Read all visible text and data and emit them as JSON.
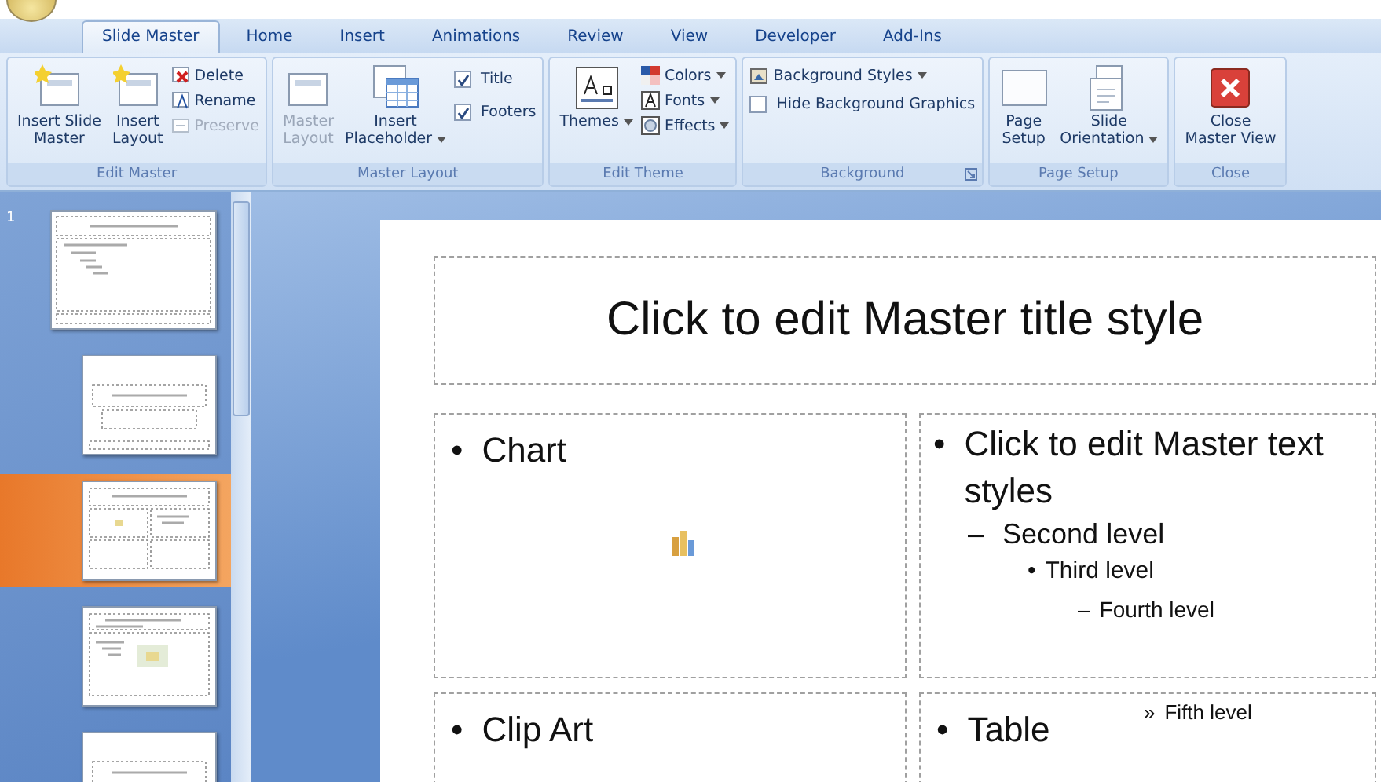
{
  "tabs": [
    {
      "label": "Slide Master",
      "selected": true
    },
    {
      "label": "Home",
      "selected": false
    },
    {
      "label": "Insert",
      "selected": false
    },
    {
      "label": "Animations",
      "selected": false
    },
    {
      "label": "Review",
      "selected": false
    },
    {
      "label": "View",
      "selected": false
    },
    {
      "label": "Developer",
      "selected": false
    },
    {
      "label": "Add-Ins",
      "selected": false
    }
  ],
  "ribbon_groups": [
    {
      "label": "Edit Master",
      "controls": [
        {
          "kind": "large",
          "lines": [
            "Insert Slide",
            "Master"
          ],
          "disabled": false,
          "dropdown": false
        },
        {
          "kind": "large",
          "lines": [
            "Insert",
            "Layout"
          ],
          "disabled": false,
          "dropdown": false
        },
        {
          "kind": "stack",
          "items": [
            {
              "kind": "small",
              "label": "Delete",
              "disabled": false,
              "dropdown": false
            },
            {
              "kind": "small",
              "label": "Rename",
              "disabled": false,
              "dropdown": false
            },
            {
              "kind": "small",
              "label": "Preserve",
              "disabled": true,
              "dropdown": false
            }
          ]
        }
      ]
    },
    {
      "label": "Master Layout",
      "controls": [
        {
          "kind": "large",
          "lines": [
            "Master",
            "Layout"
          ],
          "disabled": true,
          "dropdown": false
        },
        {
          "kind": "large",
          "lines": [
            "Insert",
            "Placeholder"
          ],
          "disabled": false,
          "dropdown": true
        },
        {
          "kind": "stack",
          "items": [
            {
              "kind": "checkbox",
              "label": "Title",
              "checked": true
            },
            {
              "kind": "checkbox",
              "label": "Footers",
              "checked": true
            }
          ]
        }
      ]
    },
    {
      "label": "Edit Theme",
      "controls": [
        {
          "kind": "large",
          "lines": [
            "Themes"
          ],
          "disabled": false,
          "dropdown": true
        },
        {
          "kind": "stack",
          "items": [
            {
              "kind": "small",
              "label": "Colors",
              "disabled": false,
              "dropdown": true
            },
            {
              "kind": "small",
              "label": "Fonts",
              "disabled": false,
              "dropdown": true
            },
            {
              "kind": "small",
              "label": "Effects",
              "disabled": false,
              "dropdown": true
            }
          ]
        }
      ]
    },
    {
      "label": "Background",
      "launcher": true,
      "controls": [
        {
          "kind": "stack",
          "items": [
            {
              "kind": "small",
              "label": "Background Styles",
              "disabled": false,
              "dropdown": true
            },
            {
              "kind": "checkbox",
              "label": "Hide Background Graphics",
              "checked": false
            }
          ]
        }
      ]
    },
    {
      "label": "Page Setup",
      "controls": [
        {
          "kind": "large",
          "lines": [
            "Page",
            "Setup"
          ],
          "disabled": false,
          "dropdown": false
        },
        {
          "kind": "large",
          "lines": [
            "Slide",
            "Orientation"
          ],
          "disabled": false,
          "dropdown": true
        }
      ]
    },
    {
      "label": "Close",
      "controls": [
        {
          "kind": "large",
          "lines": [
            "Close",
            "Master View"
          ],
          "disabled": false,
          "dropdown": false
        }
      ]
    }
  ],
  "thumbnails": [
    {
      "number": "1",
      "kind": "master",
      "selected": false
    },
    {
      "kind": "title",
      "selected": false
    },
    {
      "kind": "two_content",
      "selected": true
    },
    {
      "kind": "content_caption",
      "selected": false
    },
    {
      "kind": "title",
      "selected": false
    }
  ],
  "slide": {
    "title": "Click to edit Master title style",
    "placeholders": [
      {
        "kind": "chart",
        "marker": "•",
        "text": "Chart"
      },
      {
        "kind": "text",
        "levels": [
          {
            "marker": "•",
            "text": "Click to edit Master text styles",
            "children": [
              {
                "marker": "–",
                "text": "Second level",
                "children": [
                  {
                    "marker": "•",
                    "text": "Third level",
                    "children": [
                      {
                        "marker": "–",
                        "text": "Fourth level",
                        "children": [
                          {
                            "marker": "»",
                            "text": "Fifth level"
                          }
                        ]
                      }
                    ]
                  }
                ]
              }
            ]
          }
        ]
      },
      {
        "kind": "clipart",
        "marker": "•",
        "text": "Clip Art"
      },
      {
        "kind": "table",
        "marker": "•",
        "text": "Table"
      }
    ]
  }
}
